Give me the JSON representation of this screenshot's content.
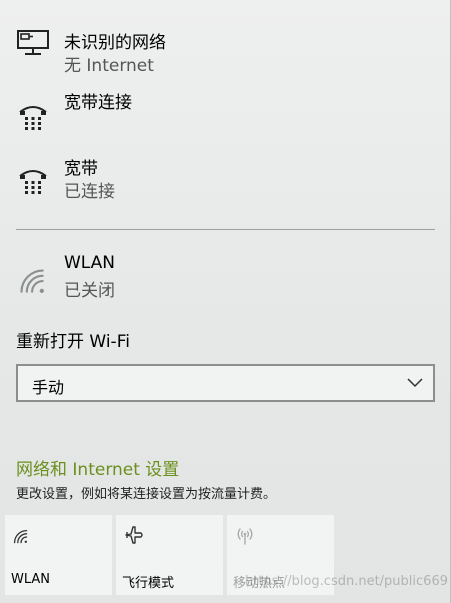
{
  "networks": [
    {
      "name": "未识别的网络",
      "status": "无 Internet",
      "icon": "monitor-network-icon"
    },
    {
      "name": "宽带连接",
      "status": "",
      "icon": "dialup-icon"
    },
    {
      "name": "宽带",
      "status": "已连接",
      "icon": "dialup-icon"
    }
  ],
  "wlan": {
    "name": "WLAN",
    "status": "已关闭",
    "icon": "wifi-icon"
  },
  "reopen_wifi": {
    "label": "重新打开 Wi-Fi",
    "selected": "手动"
  },
  "settings": {
    "link": "网络和 Internet 设置",
    "description": "更改设置，例如将某连接设置为按流量计费。"
  },
  "quick_actions": [
    {
      "label": "WLAN",
      "icon": "wifi-icon"
    },
    {
      "label": "飞行模式",
      "icon": "airplane-icon"
    },
    {
      "label": "移动热点",
      "icon": "hotspot-icon"
    }
  ],
  "watermark": "https://blog.csdn.net/public669",
  "colors": {
    "link": "#6b8f1c",
    "status": "#555555",
    "disabled": "#9ea2a2"
  }
}
